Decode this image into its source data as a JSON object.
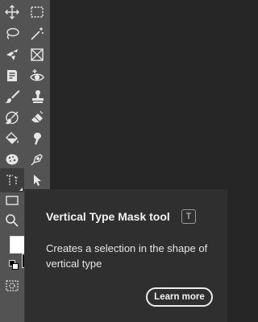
{
  "toolbar": {
    "tools": [
      {
        "name": "move-tool",
        "icon": "move-icon"
      },
      {
        "name": "rectangular-marquee-tool",
        "icon": "marquee-icon"
      },
      {
        "name": "lasso-tool",
        "icon": "lasso-icon"
      },
      {
        "name": "magic-wand-tool",
        "icon": "magic-wand-icon"
      },
      {
        "name": "crop-tool",
        "icon": "crop-icon"
      },
      {
        "name": "frame-tool",
        "icon": "frame-icon"
      },
      {
        "name": "note-tool",
        "icon": "note-icon"
      },
      {
        "name": "red-eye-tool",
        "icon": "eye-icon"
      },
      {
        "name": "brush-tool",
        "icon": "brush-icon"
      },
      {
        "name": "clone-stamp-tool",
        "icon": "stamp-icon"
      },
      {
        "name": "history-brush-tool",
        "icon": "history-brush-icon"
      },
      {
        "name": "eraser-tool",
        "icon": "eraser-icon"
      },
      {
        "name": "paint-bucket-tool",
        "icon": "bucket-icon"
      },
      {
        "name": "smudge-tool",
        "icon": "smudge-icon"
      },
      {
        "name": "sponge-tool",
        "icon": "sponge-icon"
      },
      {
        "name": "pen-tool",
        "icon": "pen-icon"
      },
      {
        "name": "vertical-type-mask-tool",
        "icon": "vertical-type-mask-icon"
      },
      {
        "name": "path-selection-tool",
        "icon": "arrow-icon"
      },
      {
        "name": "rectangle-tool",
        "icon": "rectangle-icon"
      },
      {
        "name": "zoom-tool",
        "icon": "magnifier-icon"
      },
      {
        "name": "quick-mask-tool",
        "icon": "quick-mask-icon"
      }
    ],
    "colors": {
      "foreground": "#ffffff",
      "background": "#000000"
    }
  },
  "tooltip": {
    "title": "Vertical Type Mask tool",
    "shortcut": "T",
    "description": "Creates a selection in the shape of vertical type",
    "learn_more": "Learn more"
  }
}
